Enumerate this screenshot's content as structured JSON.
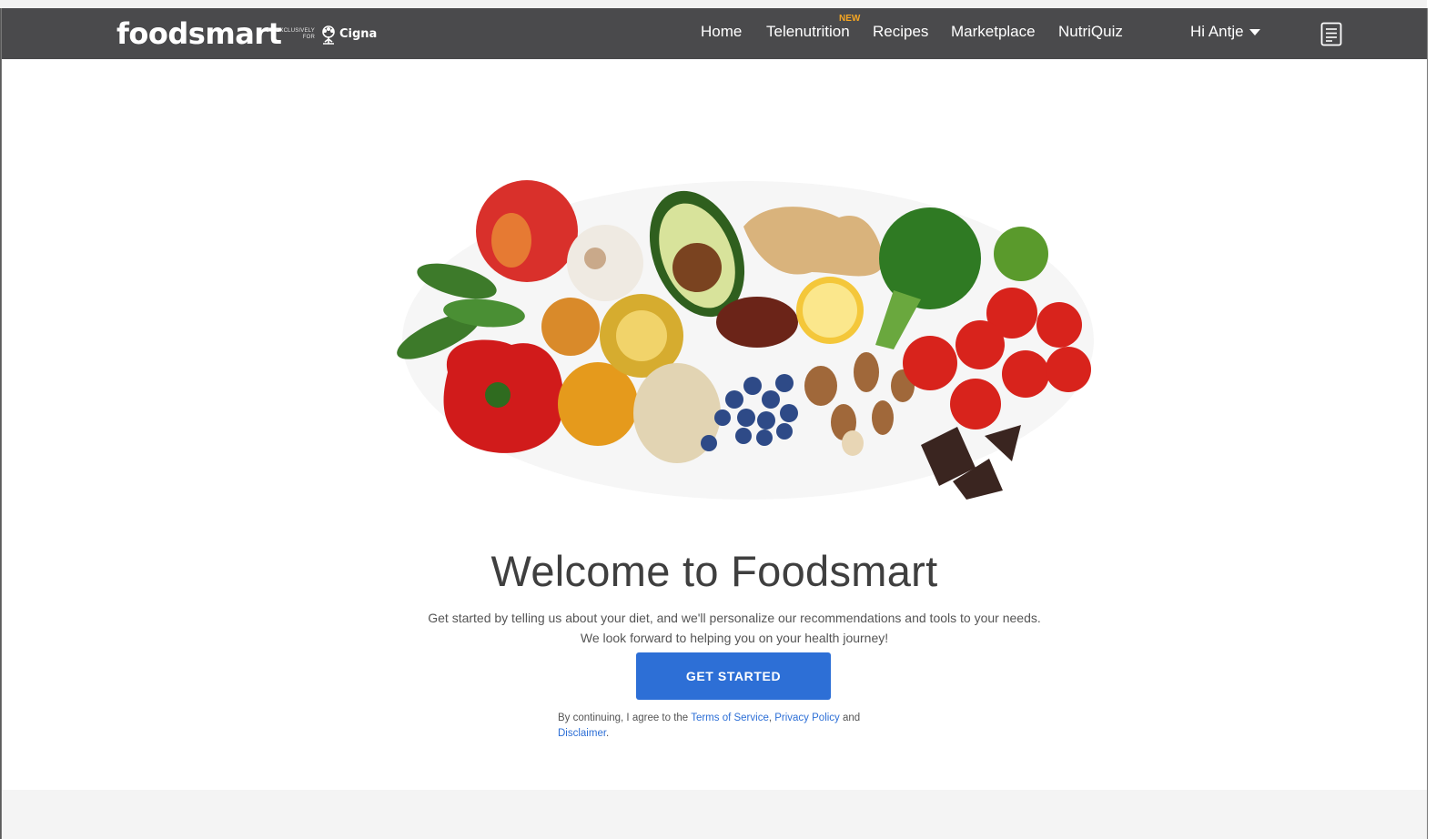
{
  "nav": {
    "brand": "foodsmart",
    "exclusive_line1": "EXCLUSIVELY",
    "exclusive_line2": "FOR",
    "partner": "Cigna",
    "links": [
      "Home",
      "Telenutrition",
      "Recipes",
      "Marketplace",
      "NutriQuiz"
    ],
    "new_badge": "NEW",
    "user_greeting": "Hi Antje",
    "icons": {
      "partner": "cigna-tree-icon",
      "dropdown": "chevron-down-icon",
      "notes": "document-list-icon"
    }
  },
  "main": {
    "title": "Welcome to Foodsmart",
    "description": "Get started by telling us about your diet, and we'll personalize our recommendations and tools to your needs. We look forward to helping you on your health journey!",
    "cta_label": "GET STARTED",
    "legal": {
      "prefix": "By continuing, I agree to the ",
      "terms": "Terms of Service",
      "sep1": ", ",
      "privacy": "Privacy Policy",
      "sep2": " and ",
      "disclaimer": "Disclaimer",
      "end": "."
    }
  },
  "colors": {
    "navbar": "#4a4a4c",
    "accent": "#2d6fd6",
    "new_badge": "#f5a623",
    "title": "#3f3f3f"
  }
}
